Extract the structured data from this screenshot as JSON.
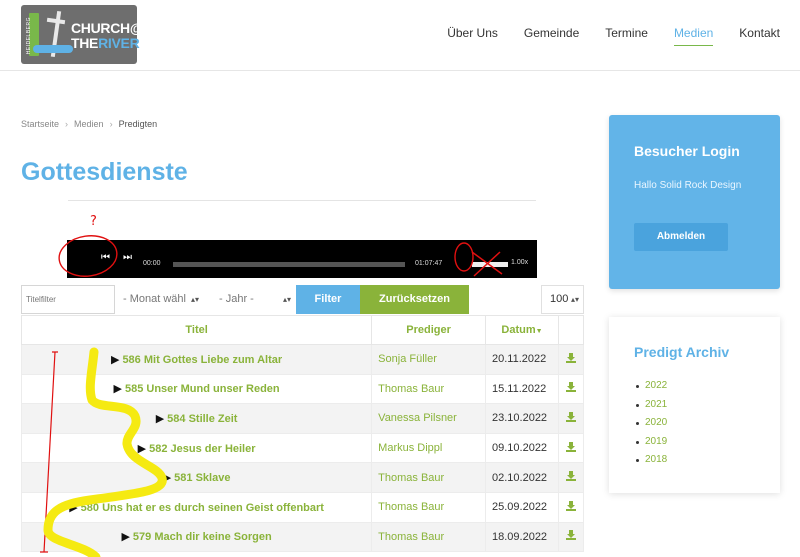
{
  "header": {
    "logo": {
      "vertical_text": "HEIDELBERG",
      "line1": "CHURCH@",
      "line2_a": "THE",
      "line2_b": "RIVER"
    },
    "nav": [
      {
        "label": "Über Uns",
        "active": false
      },
      {
        "label": "Gemeinde",
        "active": false
      },
      {
        "label": "Termine",
        "active": false
      },
      {
        "label": "Medien",
        "active": true
      },
      {
        "label": "Kontakt",
        "active": false
      }
    ]
  },
  "breadcrumb": [
    "Startseite",
    "Medien",
    "Predigten"
  ],
  "page": {
    "title": "Gottesdienste"
  },
  "player": {
    "current_time": "00:00",
    "duration": "01:07:47",
    "speed": "1.00x",
    "progress": 0.0
  },
  "filters": {
    "title_placeholder": "Titelfilter",
    "month_label": "- Monat wähl",
    "year_label": "- Jahr -",
    "filter_button": "Filter",
    "reset_button": "Zurücksetzen",
    "per_page": "100"
  },
  "table": {
    "headers": {
      "title": "Titel",
      "preacher": "Prediger",
      "date": "Datum"
    },
    "rows": [
      {
        "title": "586 Mit Gottes Liebe zum Altar",
        "preacher": "Sonja Füller",
        "date": "20.11.2022"
      },
      {
        "title": "585 Unser Mund unser Reden",
        "preacher": "Thomas Baur",
        "date": "15.11.2022"
      },
      {
        "title": "584 Stille Zeit",
        "preacher": "Vanessa Pilsner",
        "date": "23.10.2022"
      },
      {
        "title": "582 Jesus der Heiler",
        "preacher": "Markus Dippl",
        "date": "09.10.2022"
      },
      {
        "title": "581 Sklave",
        "preacher": "Thomas Baur",
        "date": "02.10.2022"
      },
      {
        "title": "580 Uns hat er es durch seinen Geist offenbart",
        "preacher": "Thomas Baur",
        "date": "25.09.2022"
      },
      {
        "title": "579 Mach dir keine Sorgen",
        "preacher": "Thomas Baur",
        "date": "18.09.2022"
      }
    ]
  },
  "sidebar": {
    "login": {
      "title": "Besucher Login",
      "greeting": "Hallo Solid Rock Design",
      "logout_button": "Abmelden"
    },
    "archive": {
      "title": "Predigt Archiv",
      "years": [
        "2022",
        "2021",
        "2020",
        "2019",
        "2018"
      ]
    }
  },
  "annotation": {
    "question_mark": "?"
  },
  "colors": {
    "brand_blue": "#5fb2e6",
    "brand_green": "#8ab33a",
    "annotation_red": "#e01010",
    "annotation_yellow": "#f5ea12"
  }
}
